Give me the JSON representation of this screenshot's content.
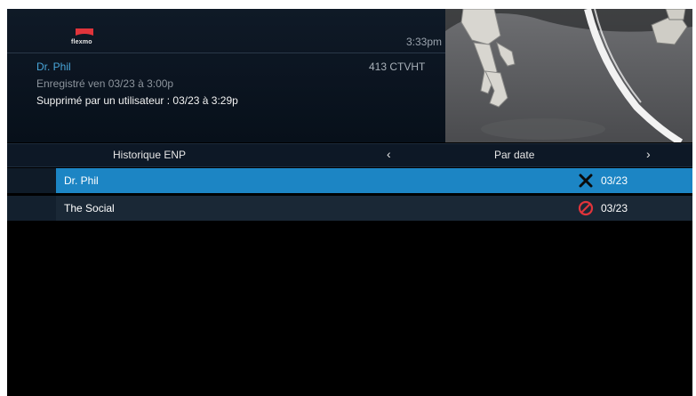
{
  "app": {
    "logo_text": "flexmo",
    "time": "3:33pm"
  },
  "program": {
    "title": "Dr. Phil",
    "channel": "413 CTVHT",
    "recorded": "Enregistré ven 03/23 à 3:00p",
    "deleted": "Supprimé par un utilisateur : 03/23 à 3:29p"
  },
  "nav": {
    "title": "Historique ENP",
    "prev_arrow": "‹",
    "sort_label": "Par date",
    "next_arrow": "›"
  },
  "list": {
    "items": [
      {
        "title": "Dr. Phil",
        "date": "03/23",
        "status_icon": "x-icon",
        "selected": true
      },
      {
        "title": "The Social",
        "date": "03/23",
        "status_icon": "prohibited-icon",
        "selected": false
      }
    ]
  },
  "colors": {
    "accent": "#1c85c4",
    "title_blue": "#49a6d9",
    "alert_red": "#e0343b"
  }
}
